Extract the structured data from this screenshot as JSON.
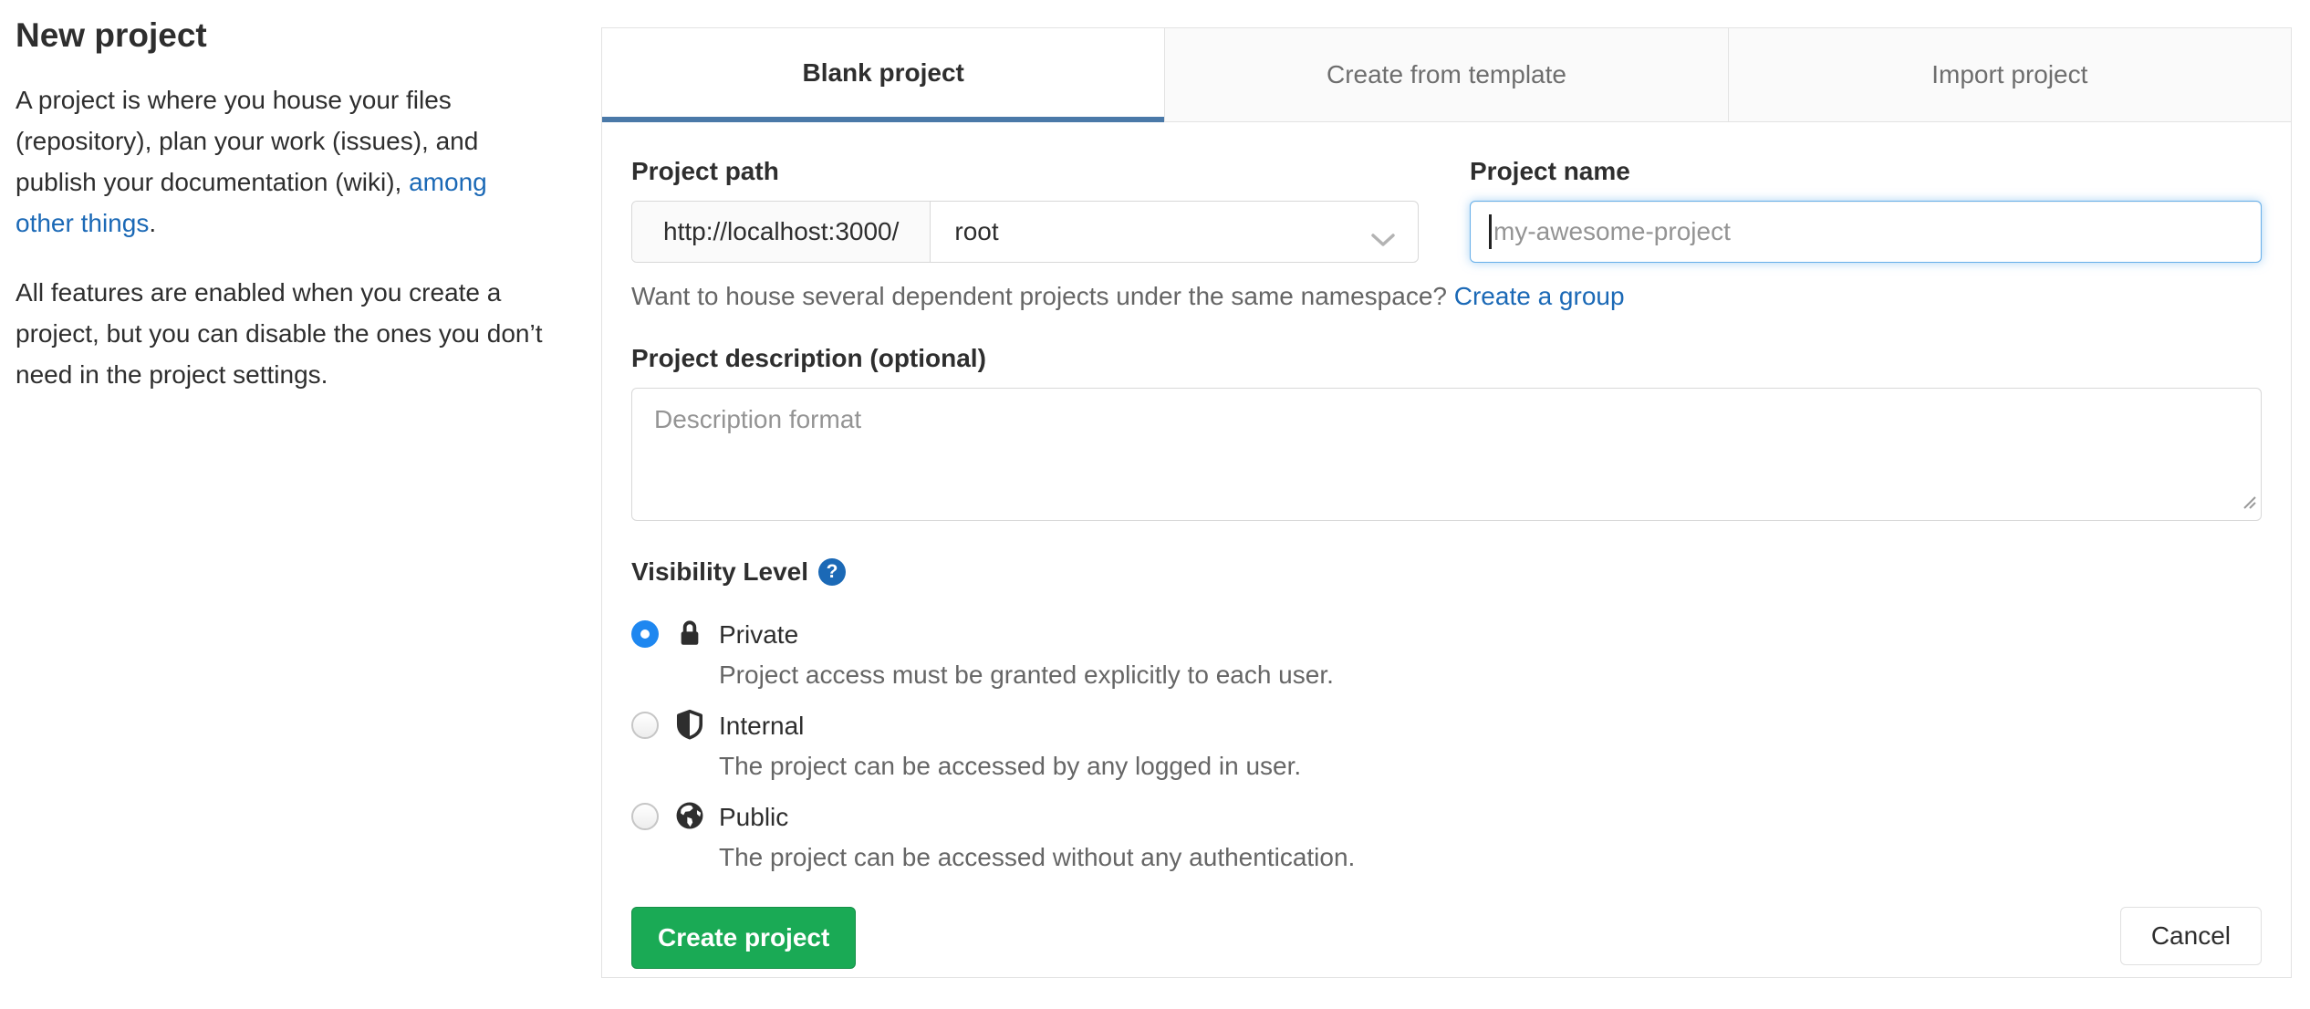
{
  "page": {
    "title": "New project",
    "intro_before_link": "A project is where you house your files (repository), plan your work (issues), and publish your documentation (wiki), ",
    "intro_link": "among other things",
    "intro_after_link": ".",
    "intro_second": "All features are enabled when you create a project, but you can disable the ones you don’t need in the project settings."
  },
  "tabs": [
    {
      "label": "Blank project",
      "active": true
    },
    {
      "label": "Create from template",
      "active": false
    },
    {
      "label": "Import project",
      "active": false
    }
  ],
  "form": {
    "project_path": {
      "label": "Project path",
      "url_prefix": "http://localhost:3000/",
      "namespace_selected": "root"
    },
    "project_name": {
      "label": "Project name",
      "placeholder": "my-awesome-project"
    },
    "namespace_help_text": "Want to house several dependent projects under the same namespace?",
    "namespace_help_link": "Create a group",
    "description": {
      "label": "Project description (optional)",
      "placeholder": "Description format"
    },
    "visibility": {
      "label": "Visibility Level",
      "help_glyph": "?",
      "options": [
        {
          "name": "Private",
          "description": "Project access must be granted explicitly to each user.",
          "selected": true,
          "icon": "lock-icon"
        },
        {
          "name": "Internal",
          "description": "The project can be accessed by any logged in user.",
          "selected": false,
          "icon": "shield-icon"
        },
        {
          "name": "Public",
          "description": "The project can be accessed without any authentication.",
          "selected": false,
          "icon": "globe-icon"
        }
      ]
    },
    "submit_label": "Create project",
    "cancel_label": "Cancel"
  },
  "colors": {
    "link": "#1b69b6",
    "active_tab_underline": "#4a79a8",
    "radio_selected": "#1e87f0",
    "submit_green": "#1aaa55",
    "help_icon_bg": "#1b69b6"
  }
}
